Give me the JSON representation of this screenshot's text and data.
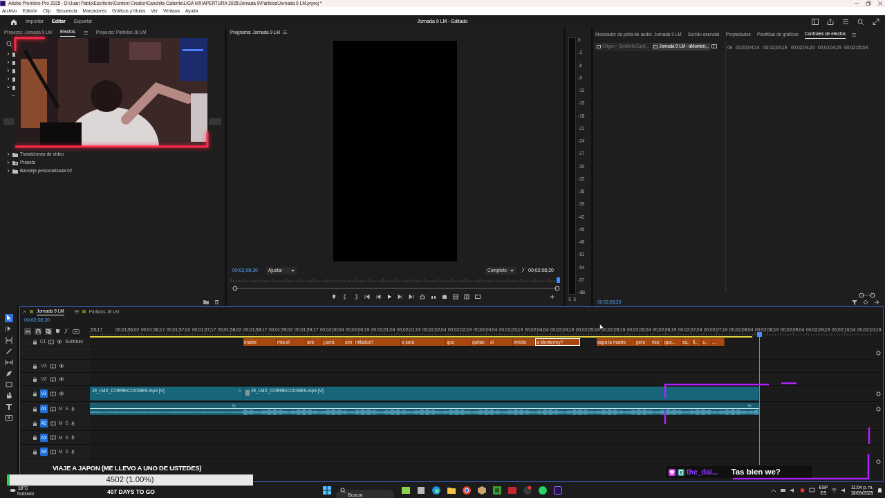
{
  "title_bar": {
    "title": "Adobe Premiere Pro 2025 - D:\\Juan Pablo\\Escritorio\\Content Creator\\Canchita Caliente\\LIGA MX\\APERTURA 2025\\Jornada 9\\Partidos\\Jornada 9 LM.prproj *"
  },
  "menu": [
    "Archivo",
    "Edición",
    "Clip",
    "Secuencia",
    "Marcadores",
    "Gráficos y títulos",
    "Ver",
    "Ventana",
    "Ayuda"
  ],
  "header": {
    "tabs": [
      {
        "label": "Importar",
        "selected": false
      },
      {
        "label": "Editar",
        "selected": true
      },
      {
        "label": "Exportar",
        "selected": false
      }
    ],
    "title": "Jornada 9 LM - Editado"
  },
  "project_panel": {
    "tabs": [
      {
        "label": "Proyecto: Jornada 9 LM",
        "selected": false
      },
      {
        "label": "Efectos",
        "selected": true
      },
      {
        "label": "Proyecto: Partidos J8 LM",
        "selected": false
      }
    ],
    "tree": [
      {
        "kind": "folder",
        "expanded": false
      },
      {
        "kind": "folder",
        "expanded": false
      },
      {
        "kind": "folder",
        "expanded": false
      },
      {
        "kind": "folder",
        "expanded": false
      },
      {
        "kind": "folder",
        "expanded": true,
        "children": [
          {
            "expanded": true
          }
        ]
      },
      {
        "kind": "folder",
        "label": "Transiciones de vídeo",
        "expanded": false
      },
      {
        "kind": "presets",
        "label": "Presets",
        "expanded": false
      },
      {
        "kind": "folder",
        "label": "Bandeja personalizada 02",
        "expanded": false
      }
    ]
  },
  "program_monitor": {
    "title": "Programa: Jornada 9 LM",
    "timecode": "00;02;08;20",
    "zoom": "Ajustar",
    "quality": "Completo",
    "duration": "00;02;08;20",
    "playhead": {
      "level": 1
    }
  },
  "audio_meter": {
    "scale": [
      "0",
      "-3",
      "-6",
      "-9",
      "-12",
      "-15",
      "-18",
      "-21",
      "-24",
      "-27",
      "-30",
      "-33",
      "-36",
      "-39",
      "-42",
      "-45",
      "-48",
      "-51",
      "-54",
      "-57",
      "-dB"
    ],
    "solo": [
      "S",
      "S"
    ]
  },
  "effect_panel": {
    "tabs": [
      {
        "label": "Mezclador de pista de audio: Jornada 9 LM",
        "selected": false
      },
      {
        "label": "Sonido esencial",
        "selected": false
      },
      {
        "label": "Propiedades",
        "selected": false
      },
      {
        "label": "Plantillas de gráficos",
        "selected": false
      },
      {
        "label": "Controles de efectos",
        "selected": true
      }
    ],
    "sources": [
      {
        "label": "Origen - SyntheticCapti...",
        "selected": false
      },
      {
        "label": "Jornada 9 LM - aMonterr...",
        "selected": true
      }
    ],
    "ruler": [
      "09",
      "00;02;04;14",
      "00;02;04;19",
      "00;02;04;24",
      "00;02;04;29",
      "00;02;05;04"
    ],
    "timecode": "00;02;08;20"
  },
  "tools": [
    {
      "kind": "select",
      "selected": true
    },
    {
      "kind": "track",
      "selected": false
    },
    {
      "kind": "ripple",
      "selected": false
    },
    {
      "kind": "razor",
      "selected": false
    },
    {
      "kind": "slip",
      "selected": false
    },
    {
      "kind": "pen",
      "selected": false
    },
    {
      "kind": "rectangle",
      "selected": false
    },
    {
      "kind": "hand",
      "selected": false
    },
    {
      "kind": "type",
      "selected": false
    },
    {
      "kind": "caption",
      "selected": false
    }
  ],
  "timeline": {
    "tabs": [
      {
        "label": "Jornada 9 LM",
        "selected": true
      },
      {
        "label": "Partidos J8 LM",
        "selected": false
      }
    ],
    "timecode": "00;02;08;20",
    "ruler": [
      ";55;17",
      "00;01;56;02",
      "00;01;56;17",
      "00;01;57;02",
      "00;01;57;17",
      "00;01;58;02",
      "00;01;58;17",
      "00;01;59;02",
      "00;01;59;17",
      "00;02;00;04",
      "00;02;00;19",
      "00;02;01;04",
      "00;02;01;19",
      "00;02;02;04",
      "00;02;02;19",
      "00;02;03;04",
      "00;02;03;19",
      "00;02;04;04",
      "00;02;04;19",
      "00;02;05;04",
      "00;02;05;19",
      "00;02;06;04",
      "00;02;06;19",
      "00;02;07;04",
      "00;02;07;19",
      "00;02;08;04",
      "00;02;08;19",
      "00;02;09;04",
      "00;02;09;19",
      "00;02;10;04",
      "00;02;10;19"
    ],
    "caption_track": {
      "label": "C1",
      "name": "Subtítulo",
      "captions": [
        {
          "text": "madre",
          "selected": false
        },
        {
          "text": "mía el",
          "selected": false
        },
        {
          "text": "ave",
          "selected": false
        },
        {
          "text": "¿será",
          "selected": false
        },
        {
          "text": "son",
          "selected": false
        },
        {
          "text": "inflados?",
          "selected": false
        },
        {
          "text": "o será",
          "selected": false
        },
        {
          "text": "que",
          "selected": false
        },
        {
          "text": "quitan",
          "selected": false
        },
        {
          "text": "el",
          "selected": false
        },
        {
          "text": "invicto",
          "selected": false
        },
        {
          "text": "a Monterrey?",
          "selected": true
        },
        {
          "text": "sepa la madre",
          "selected": false
        },
        {
          "text": "pero",
          "selected": false
        },
        {
          "text": "rico",
          "selected": false
        },
        {
          "text": "que...",
          "selected": false
        },
        {
          "text": "es..",
          "selected": false
        },
        {
          "text": "fi..",
          "selected": false
        },
        {
          "text": "s..",
          "selected": false
        },
        {
          "text": "...",
          "selected": false
        }
      ]
    },
    "video_tracks": [
      {
        "label": "V3",
        "targeted": false
      },
      {
        "label": "V2",
        "targeted": false
      },
      {
        "label": "V1",
        "targeted": true,
        "clips": [
          {
            "name": "J9_LMX_CORRECCIONES.mp4 [V]",
            "badge": "fx"
          },
          {
            "name": "J9_LMX_CORRECCIONES.mp4 [V]"
          }
        ]
      }
    ],
    "audio_tracks": [
      {
        "label": "A1",
        "targeted": true,
        "mute": "M",
        "solo": "S",
        "clips": [
          {
            "badge": "fx"
          },
          {
            "badge": "fx"
          }
        ]
      },
      {
        "label": "A2",
        "targeted": true,
        "mute": "M",
        "solo": "S"
      },
      {
        "label": "A3",
        "targeted": true,
        "mute": "M",
        "solo": "S"
      },
      {
        "label": "A4",
        "targeted": true,
        "mute": "M",
        "solo": "S"
      }
    ]
  },
  "stream_overlay": {
    "goal_title": "VIAJE A JAPON (ME LLEVO A UNO DE USTEDES)",
    "goal_progress": "4502 (1.00%)",
    "level": 0.01,
    "countdown": "407 DAYS TO GO",
    "chat": {
      "user": "the_dai...",
      "message": "Tas bien we?"
    }
  },
  "weather": {
    "temperature": "18°C",
    "condition": "Nublado"
  },
  "taskbar": {
    "search": {
      "placeholder": "Buscar"
    },
    "language": [
      "ESP",
      "ES"
    ],
    "time": "11:04 p. m.",
    "date": "18/09/2025"
  }
}
